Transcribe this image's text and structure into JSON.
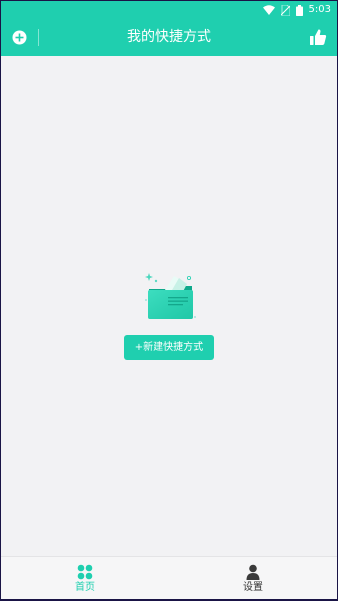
{
  "status_bar": {
    "time": "5:03",
    "icons": [
      "wifi-icon",
      "no-sim-icon",
      "battery-icon"
    ]
  },
  "header": {
    "title": "我的快捷方式",
    "left_icon": "add-circle-icon",
    "right_icon": "thumbs-up-icon"
  },
  "empty_state": {
    "illustration": "folder-with-cards-illustration",
    "button_label": "+新建快捷方式"
  },
  "bottom_nav": {
    "items": [
      {
        "label": "首页",
        "icon": "grid-icon",
        "active": true
      },
      {
        "label": "设置",
        "icon": "person-icon",
        "active": false
      }
    ]
  },
  "colors": {
    "accent": "#1fcfaf",
    "background": "#f2f2f4",
    "nav_inactive_text": "#333333"
  }
}
